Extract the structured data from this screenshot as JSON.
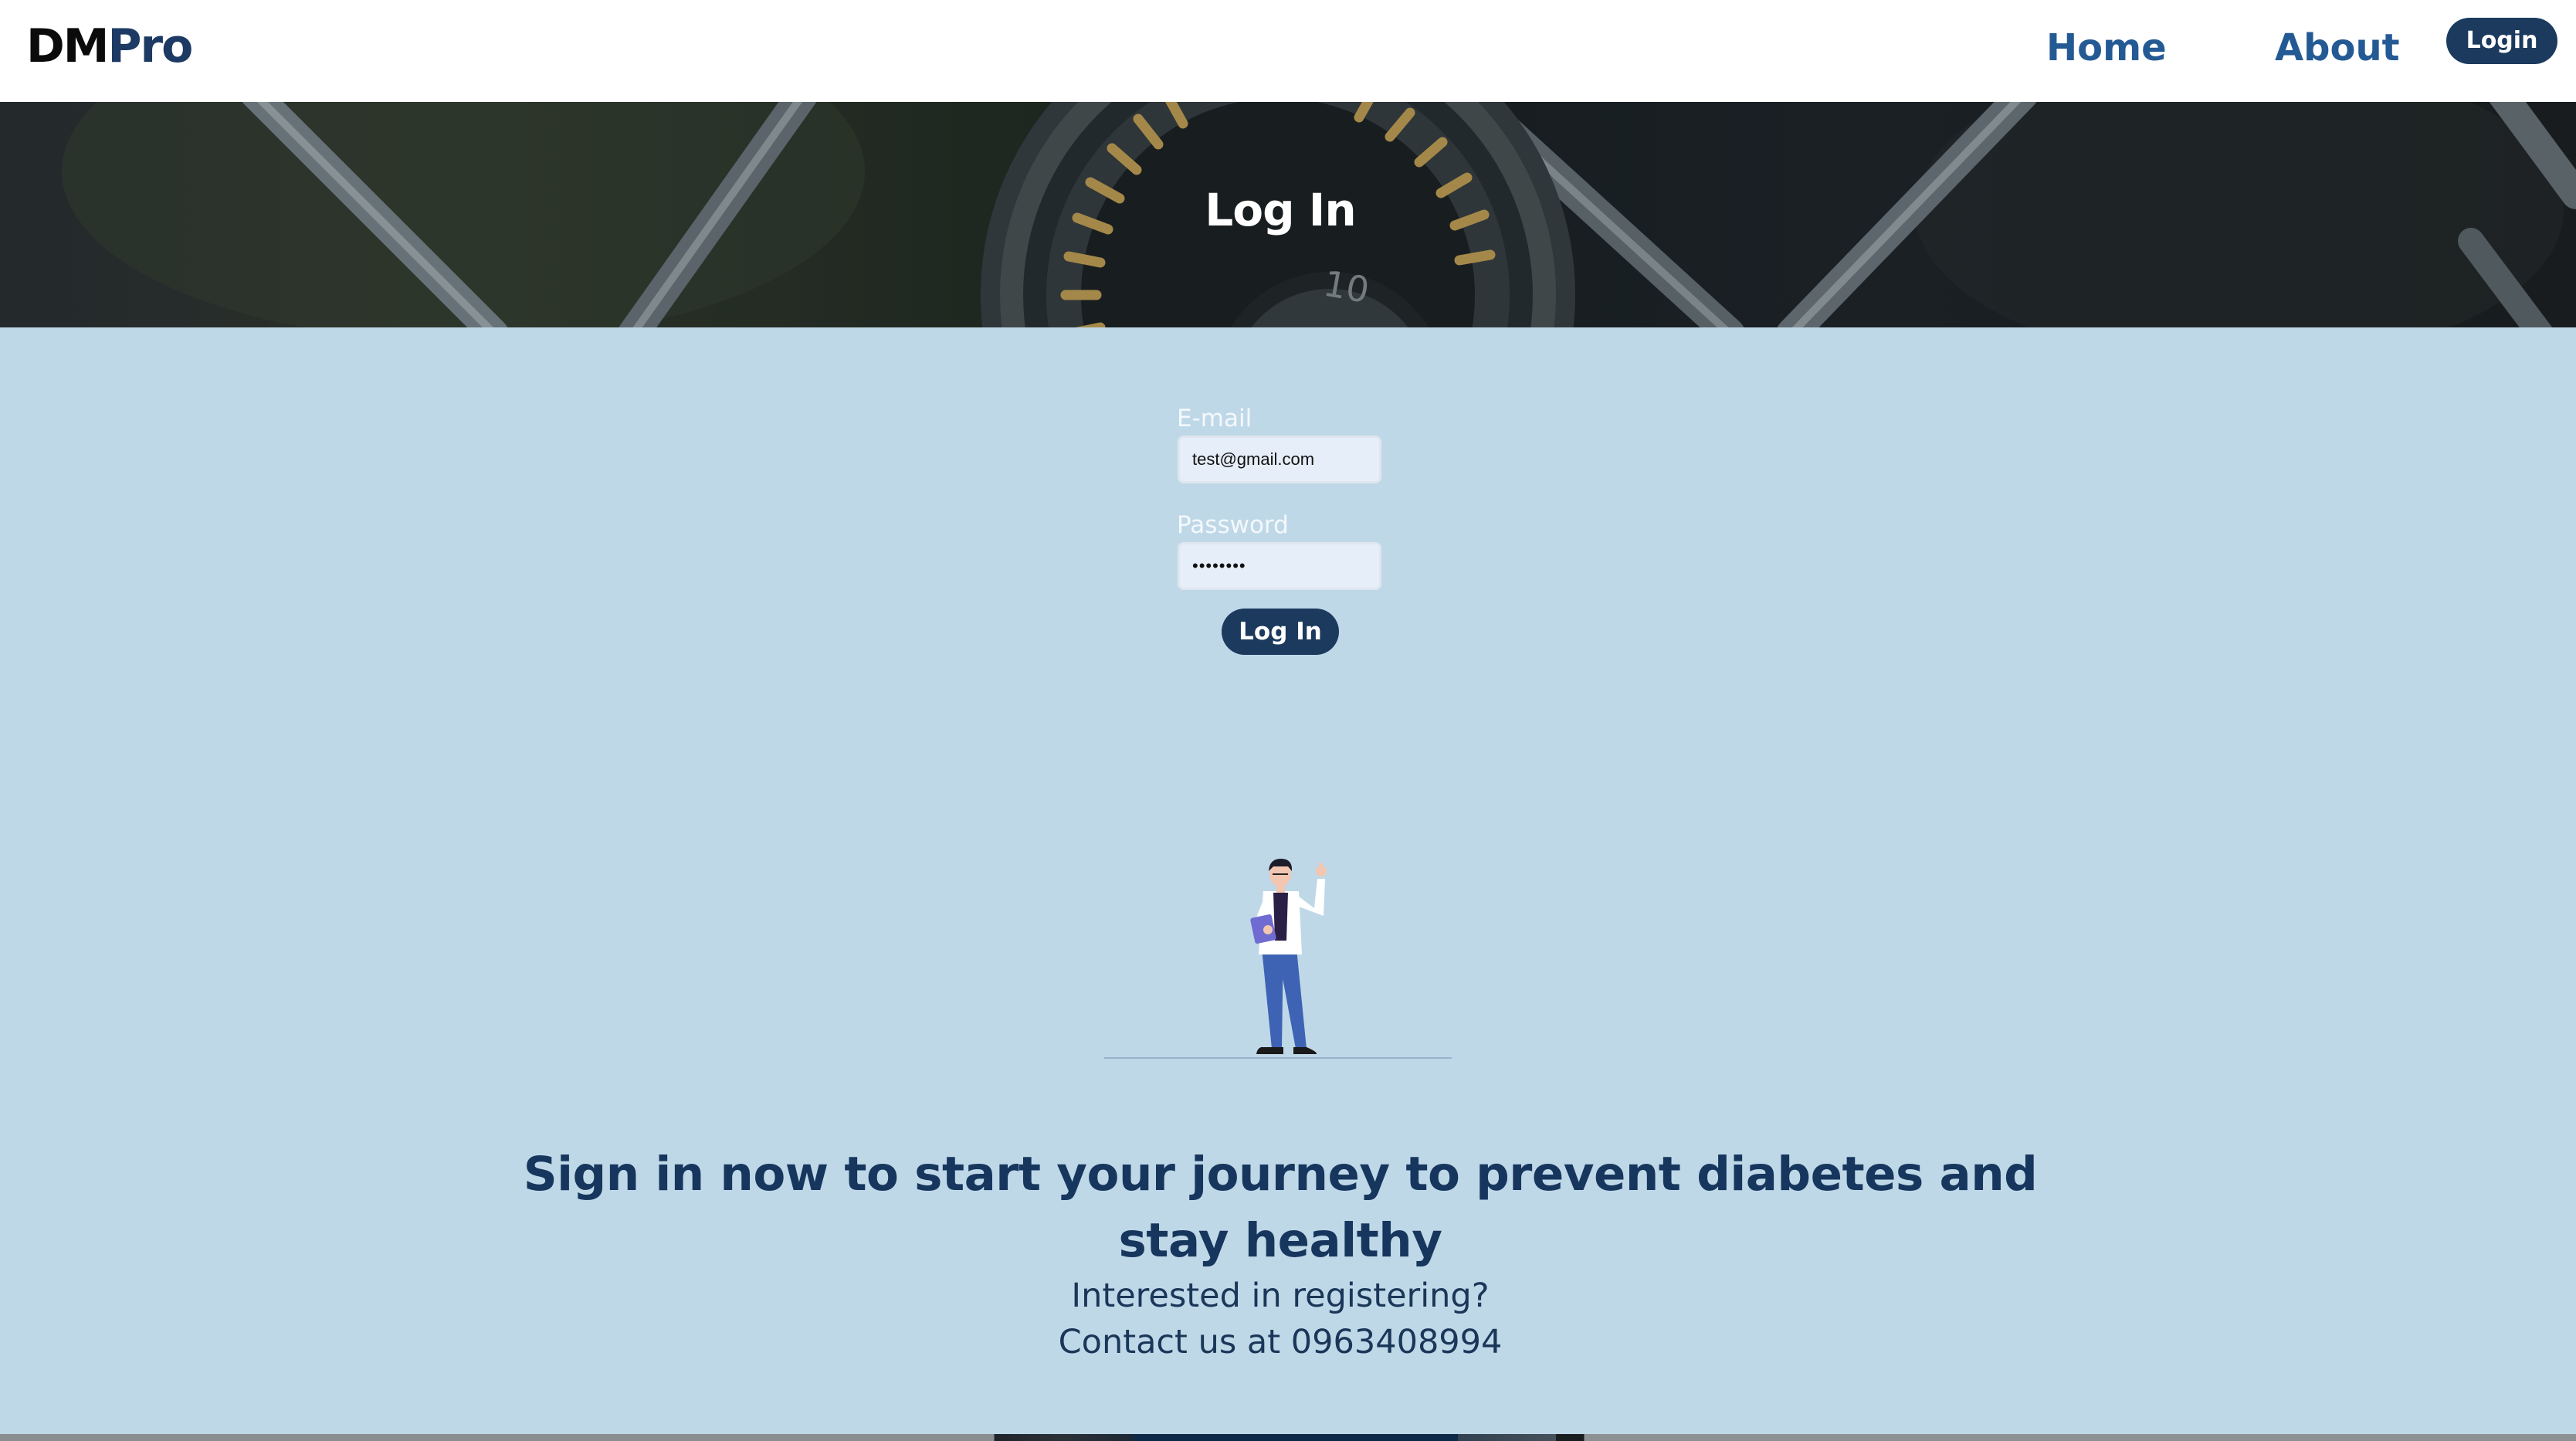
{
  "navbar": {
    "brand_primary": "DM",
    "brand_secondary": "Pro",
    "links": {
      "home": "Home",
      "about": "About"
    },
    "login_button": "Login"
  },
  "hero": {
    "title": "Log In"
  },
  "login_form": {
    "email_label": "E-mail",
    "email_value": "test@gmail.com",
    "password_label": "Password",
    "password_value": "password",
    "submit_label": "Log In"
  },
  "illustration": {
    "icon": "doctor-waving-illustration"
  },
  "cta": {
    "heading_line1": "Sign in now to start your journey to prevent diabetes and",
    "heading_line2": "stay healthy",
    "line1": "Interested in registering?",
    "line2": "Contact us at 0963408994"
  },
  "colors": {
    "accent": "#1b3a5e",
    "brand_blue": "#245a94",
    "page_background": "#bfd8e8",
    "heading_text": "#17365e"
  }
}
